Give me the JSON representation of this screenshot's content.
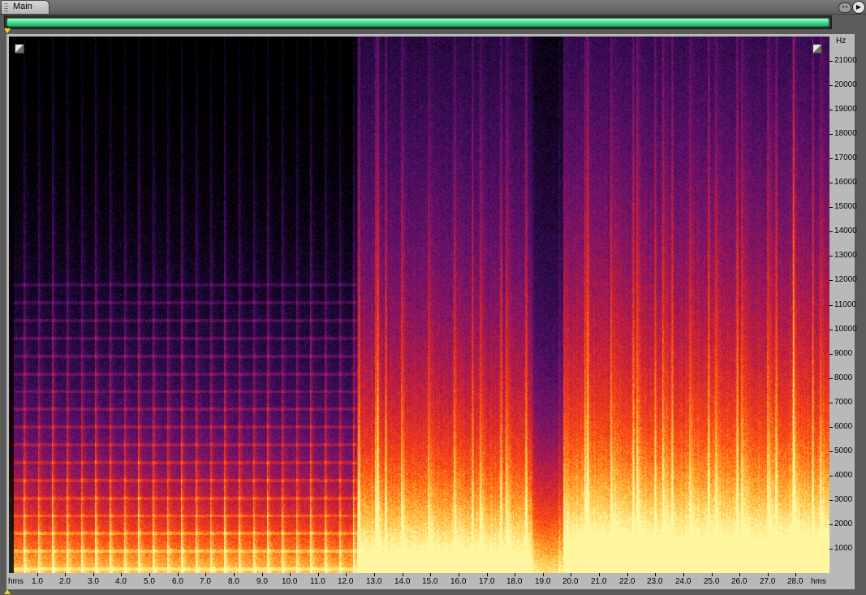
{
  "tabs": [
    {
      "label": "Main"
    }
  ],
  "overview": {
    "visible_fraction": 1.0,
    "color": "#3cd98b"
  },
  "icons": {
    "menu": "window-menu-icon",
    "play": "play-icon"
  },
  "spectrogram": {
    "colormap": [
      "#000000",
      "#2a0a4a",
      "#6e1270",
      "#c81e3a",
      "#ff4a10",
      "#ffb430",
      "#fff7a0"
    ],
    "split_time_s": 12.4,
    "quiet_band_s": [
      18.6,
      19.7
    ],
    "max_hz": 22000
  },
  "freq_axis": {
    "unit": "Hz",
    "ticks": [
      "21000",
      "20000",
      "19000",
      "18000",
      "17000",
      "16000",
      "15000",
      "14000",
      "13000",
      "12000",
      "11000",
      "10000",
      "9000",
      "8000",
      "7000",
      "6000",
      "5000",
      "4000",
      "3000",
      "2000",
      "1000"
    ],
    "tick_values": [
      21000,
      20000,
      19000,
      18000,
      17000,
      16000,
      15000,
      14000,
      13000,
      12000,
      11000,
      10000,
      9000,
      8000,
      7000,
      6000,
      5000,
      4000,
      3000,
      2000,
      1000
    ]
  },
  "time_axis": {
    "unit_left": "hms",
    "unit_right": "hms",
    "ticks": [
      "1.0",
      "2.0",
      "3.0",
      "4.0",
      "5.0",
      "6.0",
      "7.0",
      "8.0",
      "9.0",
      "10.0",
      "11.0",
      "12.0",
      "13.0",
      "14.0",
      "15.0",
      "16.0",
      "17.0",
      "18.0",
      "19.0",
      "20.0",
      "21.0",
      "22.0",
      "23.0",
      "24.0",
      "25.0",
      "26.0",
      "27.0",
      "28.0"
    ],
    "tick_values": [
      1,
      2,
      3,
      4,
      5,
      6,
      7,
      8,
      9,
      10,
      11,
      12,
      13,
      14,
      15,
      16,
      17,
      18,
      19,
      20,
      21,
      22,
      23,
      24,
      25,
      26,
      27,
      28
    ],
    "duration_s": 29.2
  }
}
